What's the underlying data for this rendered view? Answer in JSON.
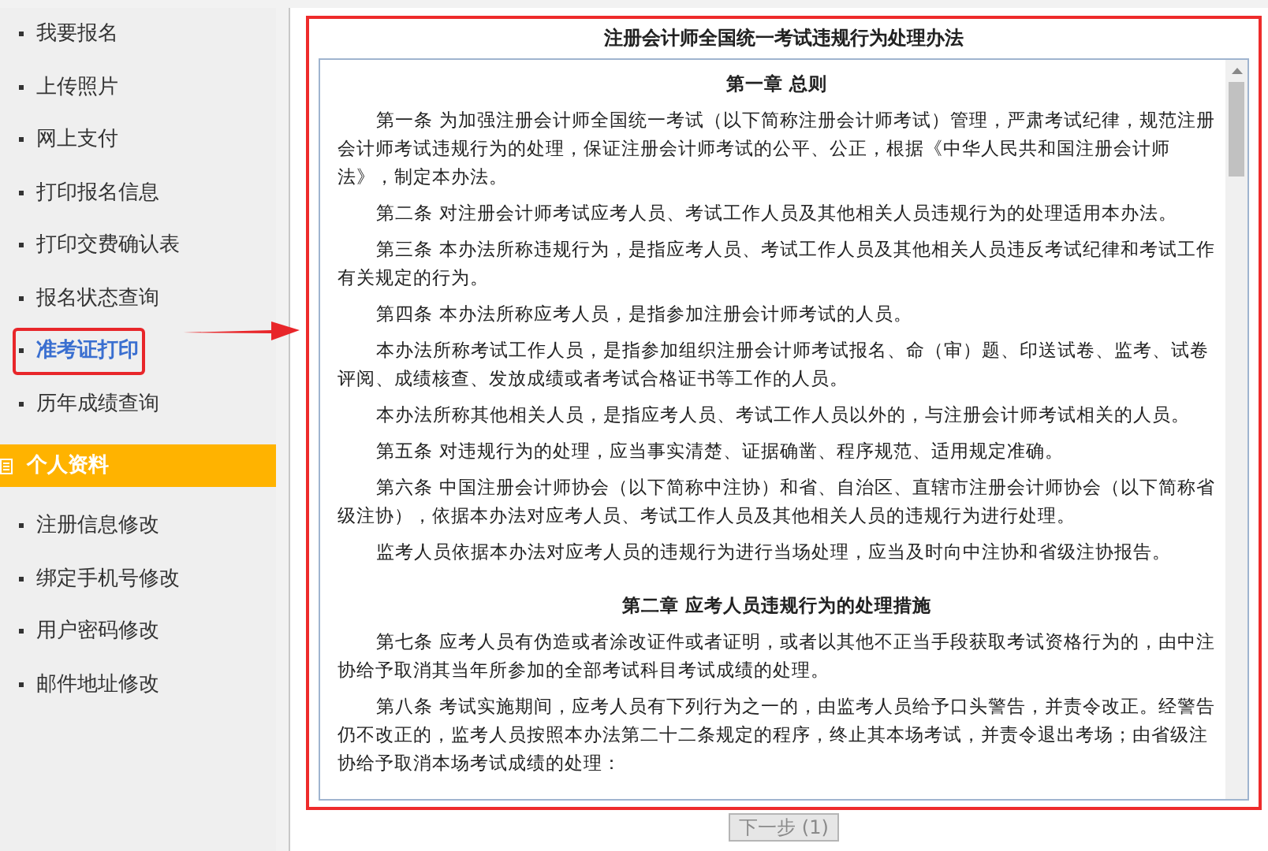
{
  "sidebar": {
    "items": [
      {
        "label": "我要报名",
        "selected": false
      },
      {
        "label": "上传照片",
        "selected": false
      },
      {
        "label": "网上支付",
        "selected": false
      },
      {
        "label": "打印报名信息",
        "selected": false
      },
      {
        "label": "打印交费确认表",
        "selected": false
      },
      {
        "label": "报名状态查询",
        "selected": false
      },
      {
        "label": "准考证打印",
        "selected": true
      },
      {
        "label": "历年成绩查询",
        "selected": false
      }
    ],
    "section": {
      "title": "个人资料",
      "items": [
        {
          "label": "注册信息修改",
          "selected": false
        },
        {
          "label": "绑定手机号修改",
          "selected": false
        },
        {
          "label": "用户密码修改",
          "selected": false
        },
        {
          "label": "邮件地址修改",
          "selected": false
        }
      ]
    }
  },
  "document": {
    "title": "注册会计师全国统一考试违规行为处理办法",
    "blocks": [
      {
        "kind": "heading",
        "text": "第一章 总则"
      },
      {
        "kind": "paragraph",
        "text": "第一条 为加强注册会计师全国统一考试（以下简称注册会计师考试）管理，严肃考试纪律，规范注册会计师考试违规行为的处理，保证注册会计师考试的公平、公正，根据《中华人民共和国注册会计师法》，制定本办法。"
      },
      {
        "kind": "paragraph",
        "text": "第二条 对注册会计师考试应考人员、考试工作人员及其他相关人员违规行为的处理适用本办法。"
      },
      {
        "kind": "paragraph",
        "text": "第三条 本办法所称违规行为，是指应考人员、考试工作人员及其他相关人员违反考试纪律和考试工作有关规定的行为。"
      },
      {
        "kind": "paragraph",
        "text": "第四条 本办法所称应考人员，是指参加注册会计师考试的人员。"
      },
      {
        "kind": "paragraph",
        "text": "本办法所称考试工作人员，是指参加组织注册会计师考试报名、命（审）题、印送试卷、监考、试卷评阅、成绩核查、发放成绩或者考试合格证书等工作的人员。"
      },
      {
        "kind": "paragraph",
        "text": "本办法所称其他相关人员，是指应考人员、考试工作人员以外的，与注册会计师考试相关的人员。"
      },
      {
        "kind": "paragraph",
        "text": "第五条 对违规行为的处理，应当事实清楚、证据确凿、程序规范、适用规定准确。"
      },
      {
        "kind": "paragraph",
        "text": "第六条 中国注册会计师协会（以下简称中注协）和省、自治区、直辖市注册会计师协会（以下简称省级注协），依据本办法对应考人员、考试工作人员及其他相关人员的违规行为进行处理。"
      },
      {
        "kind": "paragraph",
        "text": "监考人员依据本办法对应考人员的违规行为进行当场处理，应当及时向中注协和省级注协报告。"
      },
      {
        "kind": "heading",
        "text": "第二章 应考人员违规行为的处理措施"
      },
      {
        "kind": "paragraph",
        "text": "第七条 应考人员有伪造或者涂改证件或者证明，或者以其他不正当手段获取考试资格行为的，由中注协给予取消其当年所参加的全部考试科目考试成绩的处理。"
      },
      {
        "kind": "paragraph",
        "text": "第八条 考试实施期间，应考人员有下列行为之一的，由监考人员给予口头警告，并责令改正。经警告仍不改正的，监考人员按照本办法第二十二条规定的程序，终止其本场考试，并责令退出考场；由省级注协给予取消本场考试成绩的处理："
      }
    ]
  },
  "next_button": {
    "label": "下一步 (1)",
    "disabled": true
  }
}
